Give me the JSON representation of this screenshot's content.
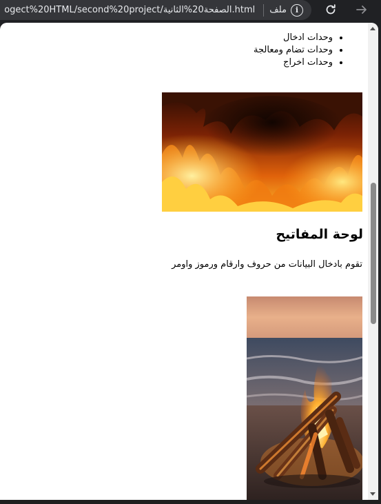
{
  "browser": {
    "url": "ogect%20HTML/second%20project/الصفحة20%الثانية.html",
    "file_label": "ملف",
    "icons": {
      "info": "info-icon",
      "reload": "reload-icon",
      "forward": "forward-arrow-icon"
    }
  },
  "page": {
    "list_items": [
      "وحدات ادخال",
      "وحدات تضام ومعالجة",
      "وحدات اخراج"
    ],
    "heading": "لوحة المفاتيح",
    "paragraph": "تقوم بادخال البيانات من حروف وارقام ورموز واومر"
  },
  "colors": {
    "chrome_bg": "#202124",
    "url_bg": "#35363a",
    "page_bg": "#ffffff",
    "text": "#000000"
  }
}
